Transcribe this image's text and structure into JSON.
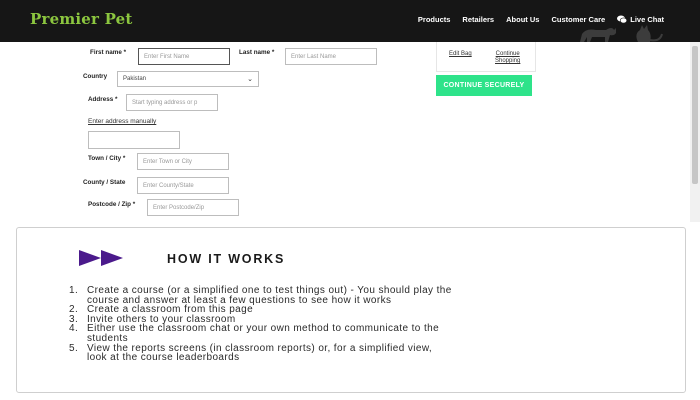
{
  "header": {
    "logo": "Premier Pet",
    "nav": [
      "Products",
      "Retailers",
      "About Us",
      "Customer Care",
      "Live Chat"
    ]
  },
  "form": {
    "first_name": {
      "label": "First name *",
      "placeholder": "Enter First Name"
    },
    "last_name": {
      "label": "Last name *",
      "placeholder": "Enter Last Name"
    },
    "country": {
      "label": "Country",
      "value": "Pakistan"
    },
    "address": {
      "label": "Address *",
      "placeholder": "Start typing address or p"
    },
    "manual_address_link": "Enter address manually",
    "town": {
      "label": "Town / City *",
      "placeholder": "Enter Town or City"
    },
    "county": {
      "label": "County / State",
      "placeholder": "Enter County/State"
    },
    "postcode": {
      "label": "Postcode / Zip *",
      "placeholder": "Enter Postcode/Zip"
    }
  },
  "side": {
    "edit_bag": "Edit Bag",
    "continue_shopping_1": "Continue",
    "continue_shopping_2": "Shopping",
    "continue_button": "CONTINUE SECURELY"
  },
  "how_it_works": {
    "title": "HOW IT WORKS",
    "steps": [
      {
        "num": "1.",
        "lines": [
          "Create a course (or a simplified one to test things out) - You should play the",
          "course and answer at least a few questions to see how it works"
        ]
      },
      {
        "num": "2.",
        "lines": [
          "Create a classroom from this page"
        ]
      },
      {
        "num": "3.",
        "lines": [
          "Invite others to your classroom"
        ]
      },
      {
        "num": "4.",
        "lines": [
          "Either use the classroom chat or your own method to communicate to the",
          "students"
        ]
      },
      {
        "num": "5.",
        "lines": [
          "View the reports screens (in classroom reports) or, for a simplified view,",
          "look at the course leaderboards"
        ]
      }
    ]
  },
  "colors": {
    "header_bg": "#161616",
    "logo": "#8cc63f",
    "continue_button": "#2ee38a",
    "arrow": "#4b1a8c"
  }
}
